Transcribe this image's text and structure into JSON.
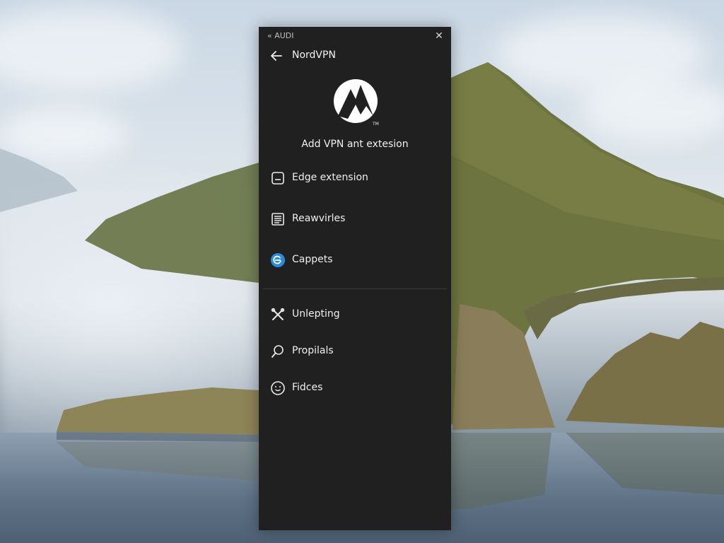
{
  "window": {
    "app_title": "« AUDI",
    "close_icon": "close-icon"
  },
  "header": {
    "back_icon": "back-arrow-icon",
    "title": "NordVPN"
  },
  "logo": {
    "name": "nordvpn-logo",
    "trademark": "TM"
  },
  "subtitle": "Add VPN ant extesion",
  "menu_primary": [
    {
      "label": "Edge extension",
      "icon": "edge-extension-icon"
    },
    {
      "label": "Reawvirles",
      "icon": "document-list-icon"
    },
    {
      "label": "Cappets",
      "icon": "edge-browser-icon",
      "icon_color": "#2b8ad9"
    }
  ],
  "menu_secondary": [
    {
      "label": "Unlepting",
      "icon": "tools-icon"
    },
    {
      "label": "Propilals",
      "icon": "profile-search-icon"
    },
    {
      "label": "Fidces",
      "icon": "smiley-icon"
    }
  ]
}
